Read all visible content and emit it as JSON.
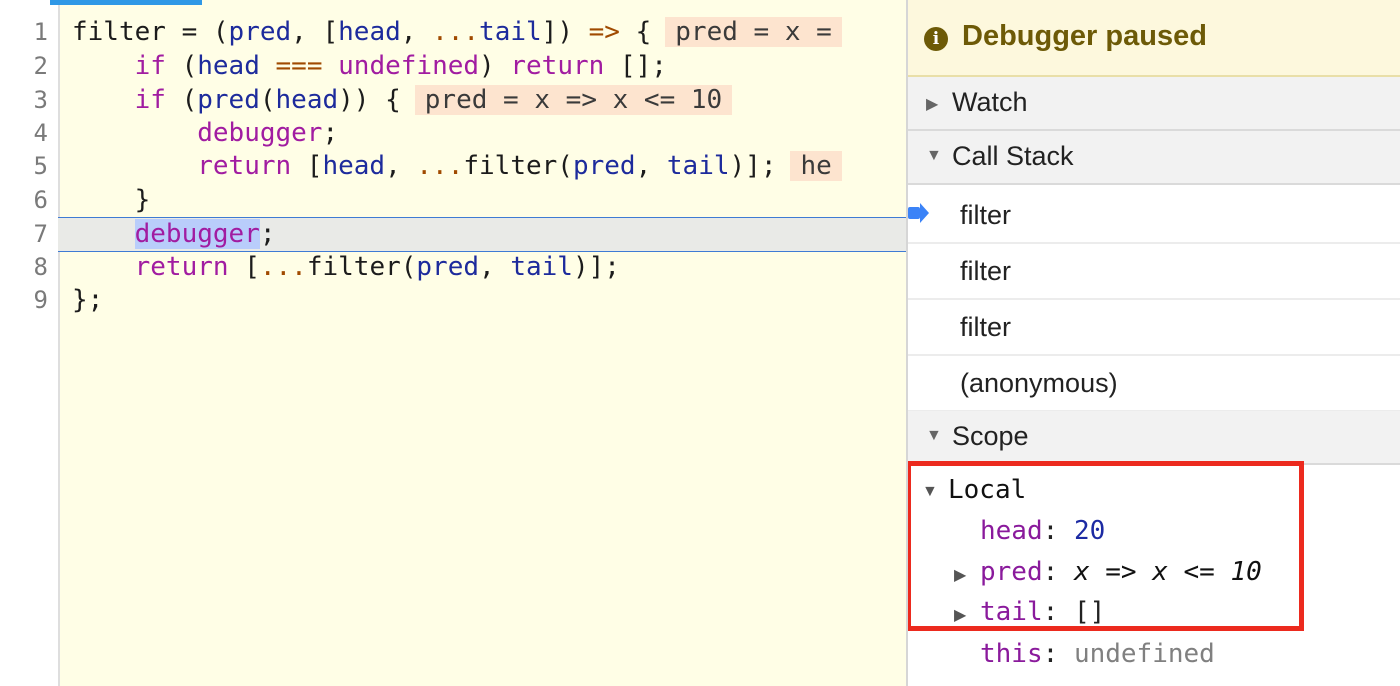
{
  "editor": {
    "line_numbers": [
      "1",
      "2",
      "3",
      "4",
      "5",
      "6",
      "7",
      "8",
      "9"
    ],
    "lines": {
      "l1": {
        "a": "filter",
        "b": " = (",
        "c": "pred",
        "d": ", [",
        "e": "head",
        "f": ", ",
        "g": "...",
        "h": "tail",
        "i": "]) ",
        "j": "=>",
        "k": " {",
        "preview": "pred = x ="
      },
      "l2": {
        "indent": "    ",
        "a": "if",
        "b": " (",
        "c": "head",
        "d": " ",
        "e": "===",
        "f": " ",
        "g": "undefined",
        "h": ") ",
        "i": "return",
        "j": " [];"
      },
      "l3": {
        "indent": "    ",
        "a": "if",
        "b": " (",
        "c": "pred",
        "d": "(",
        "e": "head",
        "f": ")) {",
        "preview": "pred = x => x <= 10"
      },
      "l4": {
        "indent": "        ",
        "a": "debugger",
        "b": ";"
      },
      "l5": {
        "indent": "        ",
        "a": "return",
        "b": " [",
        "c": "head",
        "d": ", ",
        "e": "...",
        "f": "filter(",
        "g": "pred",
        "h": ", ",
        "i": "tail",
        "j": ")];",
        "preview": "he"
      },
      "l6": {
        "indent": "    ",
        "a": "}"
      },
      "l7": {
        "indent": "    ",
        "a": "debugger",
        "b": ";"
      },
      "l8": {
        "indent": "    ",
        "a": "return",
        "b": " [",
        "c": "...",
        "d": "filter(",
        "e": "pred",
        "f": ", ",
        "g": "tail",
        "h": ")];"
      },
      "l9": {
        "a": "};"
      }
    }
  },
  "sidebar": {
    "status": "Debugger paused",
    "status_icon": "info-icon",
    "watch_label": "Watch",
    "call_stack_label": "Call Stack",
    "frames": [
      "filter",
      "filter",
      "filter",
      "(anonymous)"
    ],
    "scope_label": "Scope",
    "scope": {
      "local_label": "Local",
      "vars": [
        {
          "name": "head",
          "colon": ":",
          "value": "20"
        },
        {
          "name": "pred",
          "colon": ":",
          "value": "x => x <= 10"
        },
        {
          "name": "tail",
          "colon": ":",
          "value": "[]"
        },
        {
          "name": "this",
          "colon": ":",
          "value": "undefined"
        }
      ]
    }
  },
  "colors": {
    "editor_bg": "#fffee6",
    "keyword": "#a11ca1",
    "variable": "#1d2b9c",
    "highlight_box": "#ec2a1e",
    "paused_text": "#6d5a07",
    "frame_marker": "#3b83f7"
  }
}
